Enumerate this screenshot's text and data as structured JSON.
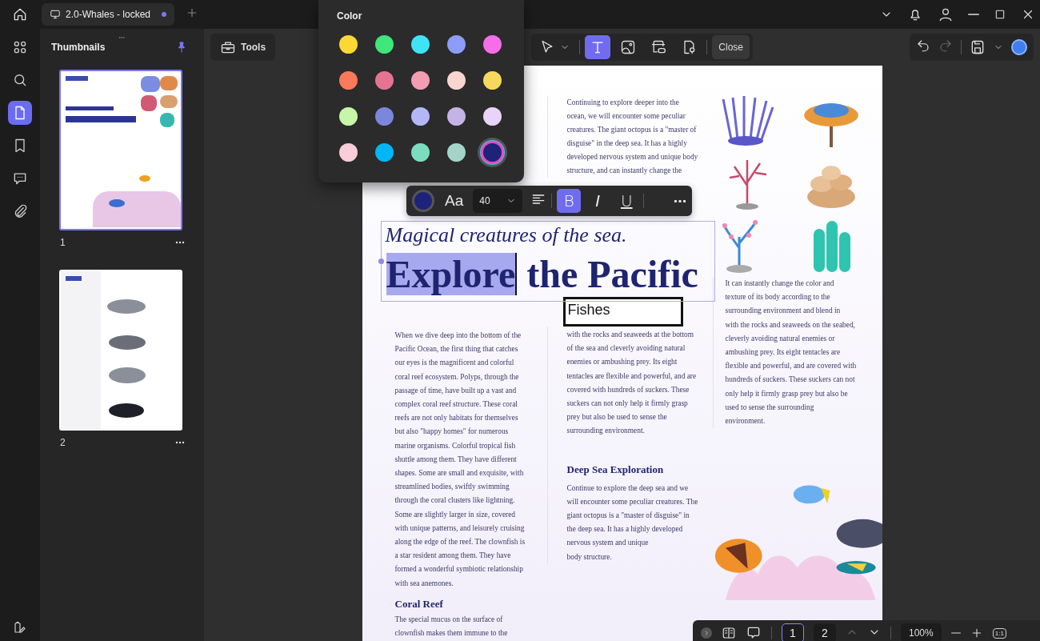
{
  "tab_bar": {
    "tabs": [
      {
        "title": "2.0-Whales - locked",
        "selected": true,
        "modified": true
      }
    ]
  },
  "left_rail": {
    "items": [
      {
        "kind": "apps",
        "selected": false
      },
      {
        "kind": "search",
        "selected": false
      },
      {
        "kind": "pages",
        "selected": true
      },
      {
        "kind": "bookmark",
        "selected": false
      },
      {
        "kind": "comment",
        "selected": false
      },
      {
        "kind": "attachment",
        "selected": false
      }
    ]
  },
  "thumbnails_panel": {
    "title": "Thumbnails",
    "pinned": true,
    "pages": [
      {
        "label": "1",
        "selected": true,
        "kind": "reef"
      },
      {
        "label": "2",
        "selected": false,
        "kind": "whales"
      }
    ]
  },
  "toolbar": {
    "tools_button": "Tools",
    "tools": [
      {
        "kind": "select",
        "selected": false
      },
      {
        "kind": "text",
        "selected": true
      },
      {
        "kind": "image",
        "selected": false
      },
      {
        "kind": "link",
        "selected": false
      },
      {
        "kind": "stamp",
        "selected": false
      }
    ],
    "close_button": "Close",
    "undo_enabled": true,
    "redo_enabled": false
  },
  "color_picker": {
    "title": "Color",
    "swatches": [
      {
        "kind": "swatch",
        "color": "#fdd835",
        "selected": false
      },
      {
        "kind": "swatch",
        "color": "#3fe67a",
        "selected": false
      },
      {
        "kind": "swatch",
        "color": "#3fe3f5",
        "selected": false
      },
      {
        "kind": "swatch",
        "color": "#8d9cf8",
        "selected": false
      },
      {
        "kind": "swatch",
        "color": "#f56ee8",
        "selected": false
      },
      {
        "kind": "swatch",
        "color": "#f97a5a",
        "selected": false
      },
      {
        "kind": "swatch",
        "color": "#e57493",
        "selected": false
      },
      {
        "kind": "swatch",
        "color": "#f49db0",
        "selected": false
      },
      {
        "kind": "swatch",
        "color": "#f9d5d0",
        "selected": false
      },
      {
        "kind": "swatch",
        "color": "#f6d95c",
        "selected": false
      },
      {
        "kind": "swatch",
        "color": "#c7f6a8",
        "selected": false
      },
      {
        "kind": "swatch",
        "color": "#7b86dd",
        "selected": false
      },
      {
        "kind": "swatch",
        "color": "#b3b7f7",
        "selected": false
      },
      {
        "kind": "swatch",
        "color": "#c4b3e5",
        "selected": false
      },
      {
        "kind": "swatch",
        "color": "#ead3f8",
        "selected": false
      },
      {
        "kind": "swatch",
        "color": "#f8ccd8",
        "selected": false
      },
      {
        "kind": "swatch",
        "color": "#00b6f5",
        "selected": false
      },
      {
        "kind": "swatch",
        "color": "#7cdcc0",
        "selected": false
      },
      {
        "kind": "swatch",
        "color": "#a4d4c8",
        "selected": false
      },
      {
        "kind": "custom",
        "color": "#1e237a",
        "selected": true
      }
    ]
  },
  "text_format_bar": {
    "color": "#1e237a",
    "font_button": "Aa",
    "font_size": "40",
    "bold_label": "B",
    "bold": true,
    "italic_label": "I",
    "italic": false,
    "underline_label": "U",
    "underline": false
  },
  "document": {
    "top_paragraph": "Continuing to explore deeper into the\nocean, we will encounter some peculiar\ncreatures. The giant octopus is a \"master of\ndisguise\" in the deep sea. It has a highly\ndeveloped nervous system and unique body\nstructure, and can instantly change the",
    "subtitle": "Magical creatures of the sea.",
    "headline": [
      {
        "text": "Explore",
        "selected": true
      },
      {
        "text": "the Pacific",
        "selected": false
      }
    ],
    "text_box": "Fishes",
    "columns": [
      {
        "blocks": [
          {
            "kind": "paragraph",
            "text": "When we dive deep into the bottom of the\nPacific Ocean, the first thing that catches\nour eyes is the magnificent and colorful\ncoral reef ecosystem. Polyps, through the\npassage of time, have built up a vast and\ncomplex coral reef structure. These coral\nreefs are not only habitats for themselves\nbut also \"happy homes\" for numerous\nmarine organisms. Colorful tropical fish\nshuttle among them. They have different\nshapes. Some are small and exquisite, with\nstreamlined bodies, swiftly swimming\nthrough the coral clusters like lightning.\nSome are slightly larger in size, covered\nwith unique patterns, and leisurely cruising\nalong the edge of the reef. The clownfish is\na star resident among them. They have\nformed a wonderful symbiotic relationship\nwith sea anemones."
          },
          {
            "kind": "heading",
            "text": "Coral Reef"
          },
          {
            "kind": "paragraph",
            "text": "The special mucus on the surface of\nclownfish makes them immune to the"
          }
        ]
      },
      {
        "blocks": [
          {
            "kind": "paragraph",
            "text": "with the rocks and seaweeds at the bottom\nof the sea and cleverly avoiding natural\nenemies or ambushing prey. Its eight\ntentacles are flexible and powerful, and are\ncovered with hundreds of suckers. These\nsuckers can not only help it firmly grasp\nprey but also be used to sense the\nsurrounding environment."
          },
          {
            "kind": "heading",
            "text": "Deep Sea Exploration"
          },
          {
            "kind": "paragraph",
            "text": "Continue to explore the deep sea and we\nwill encounter some peculiar creatures. The\ngiant octopus is a \"master of disguise\" in\nthe deep sea. It has a highly developed\nnervous system and unique\nbody structure."
          }
        ]
      },
      {
        "blocks": [
          {
            "kind": "paragraph",
            "text": "It can instantly change the color and\ntexture of its body according to the\nsurrounding environment and blend in\nwith the rocks and seaweeds on the seabed,\ncleverly avoiding natural enemies or\nambushing prey. Its eight tentacles are\nflexible and powerful, and are covered with\nhundreds of suckers. These suckers can not\nonly help it firmly grasp prey but also be\nused to sense the surrounding\nenvironment."
          }
        ]
      }
    ]
  },
  "status_bar": {
    "pages": [
      {
        "label": "1",
        "selected": true
      },
      {
        "label": "2",
        "selected": false
      }
    ],
    "prev_enabled": false,
    "next_enabled": true,
    "zoom": "100%",
    "actual_size": "1:1"
  }
}
